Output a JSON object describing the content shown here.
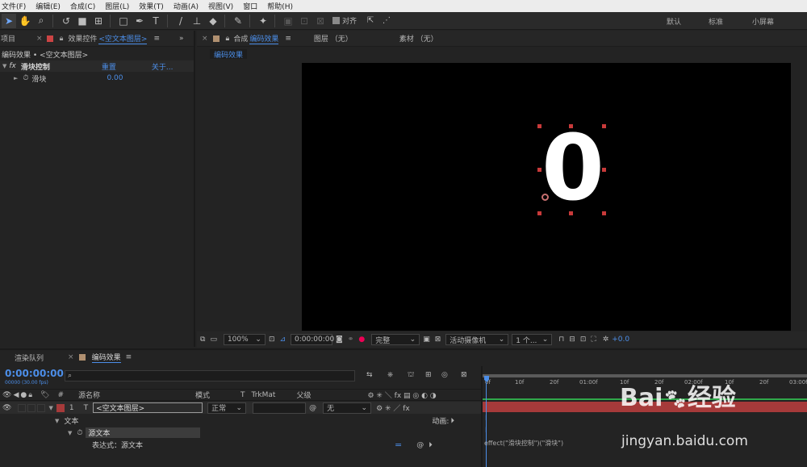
{
  "menu": {
    "items": [
      "文件(F)",
      "编辑(E)",
      "合成(C)",
      "图层(L)",
      "效果(T)",
      "动画(A)",
      "视图(V)",
      "窗口",
      "帮助(H)"
    ]
  },
  "toolbar": {
    "snap_label": "对齐",
    "workspaces": [
      "默认",
      "标准",
      "小屏幕"
    ]
  },
  "project_panel": {
    "tab": "项目"
  },
  "effects_panel": {
    "tab_prefix": "效果控件",
    "tab_layer": "<空文本图层>",
    "breadcrumb": "编码效果 • <空文本图层>",
    "effect_name": "滑块控制",
    "reset": "重置",
    "about": "关于...",
    "property": "滑块",
    "property_value": "0.00"
  },
  "comp_panel": {
    "tab_prefix": "合成",
    "tab_name": "编码效果",
    "layer_tab": "图层 （无）",
    "footage_tab": "素材 （无）",
    "subtab": "编码效果",
    "display_char": "0"
  },
  "viewer_toolbar": {
    "zoom": "100%",
    "timecode": "0:00:00:00",
    "resolution": "完整",
    "camera": "活动摄像机",
    "views": "1 个...",
    "exposure": "+0.0"
  },
  "timeline": {
    "render_tab": "渲染队列",
    "comp_tab": "编码效果",
    "timecode": "0:00:00:00",
    "timecode_sub": "00000 (30.00 fps)",
    "search_placeholder": "",
    "col_num": "#",
    "col_source": "源名称",
    "col_mode": "模式",
    "col_t": "T",
    "col_trkmat": "TrkMat",
    "col_parent": "父级",
    "layer_num": "1",
    "layer_type": "T",
    "layer_name": "<空文本图层>",
    "layer_mode": "正常",
    "layer_parent": "无",
    "text_group": "文本",
    "source_text": "源文本",
    "anim_label": "动画:",
    "expr_label": "表达式：源文本",
    "expr_eq": "=",
    "expression": "effect(\"滑块控制\")(\"滑块\")",
    "ruler": [
      "0f",
      "10f",
      "20f",
      "01:00f",
      "10f",
      "20f",
      "02:00f",
      "10f",
      "20f",
      "03:00f"
    ]
  },
  "watermark": {
    "brand": "Bai",
    "brand2": "经验",
    "site": "jingyan.baidu.com"
  },
  "colors": {
    "accent": "#4c8ee8",
    "label_red": "#a63a3a",
    "bar_green": "#2fa84a"
  }
}
